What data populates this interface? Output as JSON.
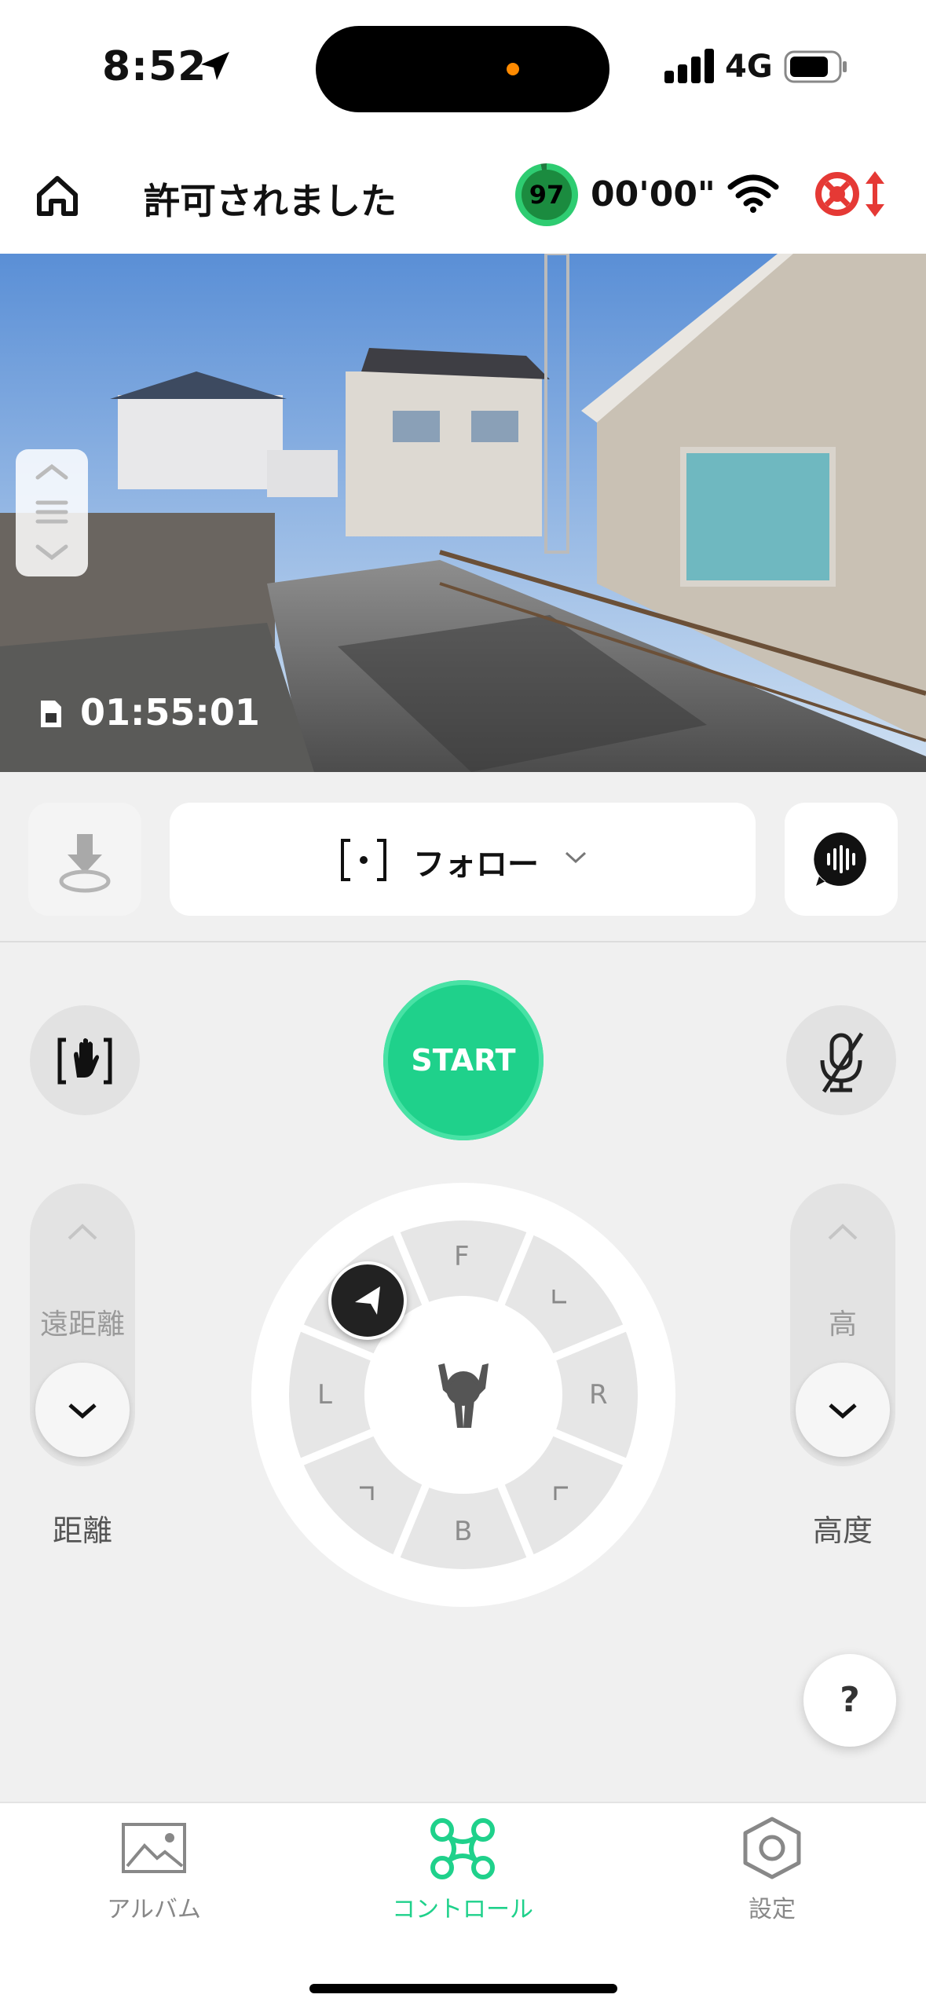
{
  "status_bar": {
    "time": "8:52",
    "network": "4G"
  },
  "header": {
    "title": "許可されました",
    "battery": "97",
    "flight_time": "00'00\""
  },
  "video": {
    "recording_time": "01:55:01"
  },
  "mode": {
    "label": "フォロー"
  },
  "controls": {
    "start_label": "START",
    "distance": {
      "value_label": "遠距離",
      "caption": "距離"
    },
    "height": {
      "value_label": "高",
      "caption": "高度"
    },
    "dial": {
      "front": "F",
      "back": "B",
      "left": "L",
      "right": "R"
    },
    "help_label": "?"
  },
  "tabs": [
    {
      "label": "アルバム",
      "active": false
    },
    {
      "label": "コントロール",
      "active": true
    },
    {
      "label": "設定",
      "active": false
    }
  ],
  "colors": {
    "accent": "#1fd18b",
    "warning": "#e53935",
    "battery": "#1b8b3f"
  }
}
